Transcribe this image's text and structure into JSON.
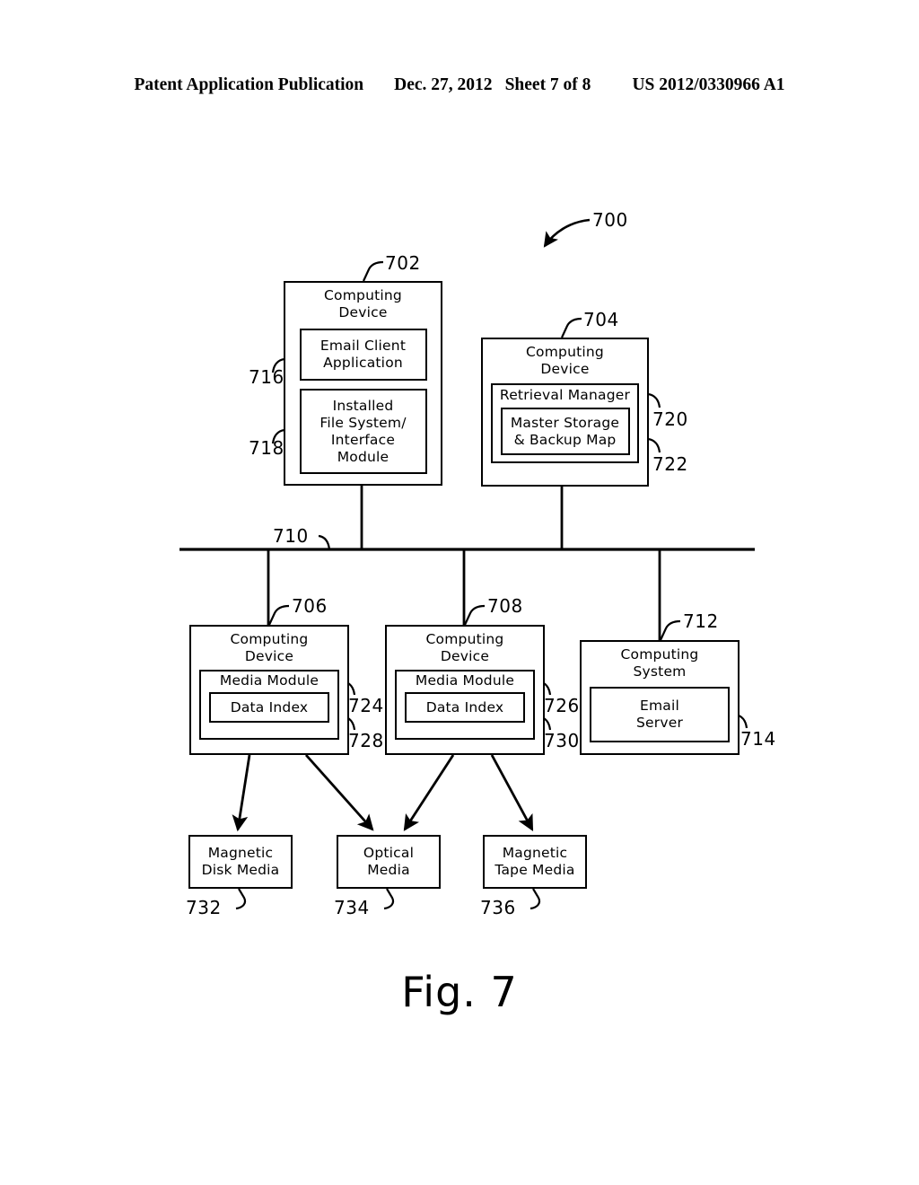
{
  "header": {
    "publication": "Patent Application Publication",
    "date": "Dec. 27, 2012",
    "sheet": "Sheet 7 of 8",
    "number": "US 2012/0330966 A1"
  },
  "figure": {
    "caption": "Fig. 7",
    "system_ref": "700"
  },
  "nodes": {
    "computing_device_702": {
      "ref": "702",
      "title": "Computing\nDevice",
      "children": [
        {
          "ref": "716",
          "label": "Email Client\nApplication"
        },
        {
          "ref": "718",
          "label": "Installed\nFile System/\nInterface\nModule"
        }
      ]
    },
    "computing_device_704": {
      "ref": "704",
      "title": "Computing\nDevice",
      "children": [
        {
          "ref": "720",
          "label": "Retrieval Manager"
        },
        {
          "ref": "722",
          "label": "Master Storage\n& Backup Map"
        }
      ]
    },
    "network_bus_710": {
      "ref": "710"
    },
    "computing_device_706": {
      "ref": "706",
      "title": "Computing\nDevice",
      "children": [
        {
          "ref": "724",
          "label": "Media Module"
        },
        {
          "ref": "728",
          "label": "Data Index"
        }
      ]
    },
    "computing_device_708": {
      "ref": "708",
      "title": "Computing\nDevice",
      "children": [
        {
          "ref": "726",
          "label": "Media Module"
        },
        {
          "ref": "730",
          "label": "Data Index"
        }
      ]
    },
    "computing_system_712": {
      "ref": "712",
      "title": "Computing\nSystem",
      "children": [
        {
          "ref": "714",
          "label": "Email\nServer"
        }
      ]
    },
    "magnetic_disk_media_732": {
      "ref": "732",
      "label": "Magnetic\nDisk Media"
    },
    "optical_media_734": {
      "ref": "734",
      "label": "Optical\nMedia"
    },
    "magnetic_tape_media_736": {
      "ref": "736",
      "label": "Magnetic\nTape Media"
    }
  },
  "colors": {
    "ink": "#000000",
    "paper": "#ffffff"
  }
}
